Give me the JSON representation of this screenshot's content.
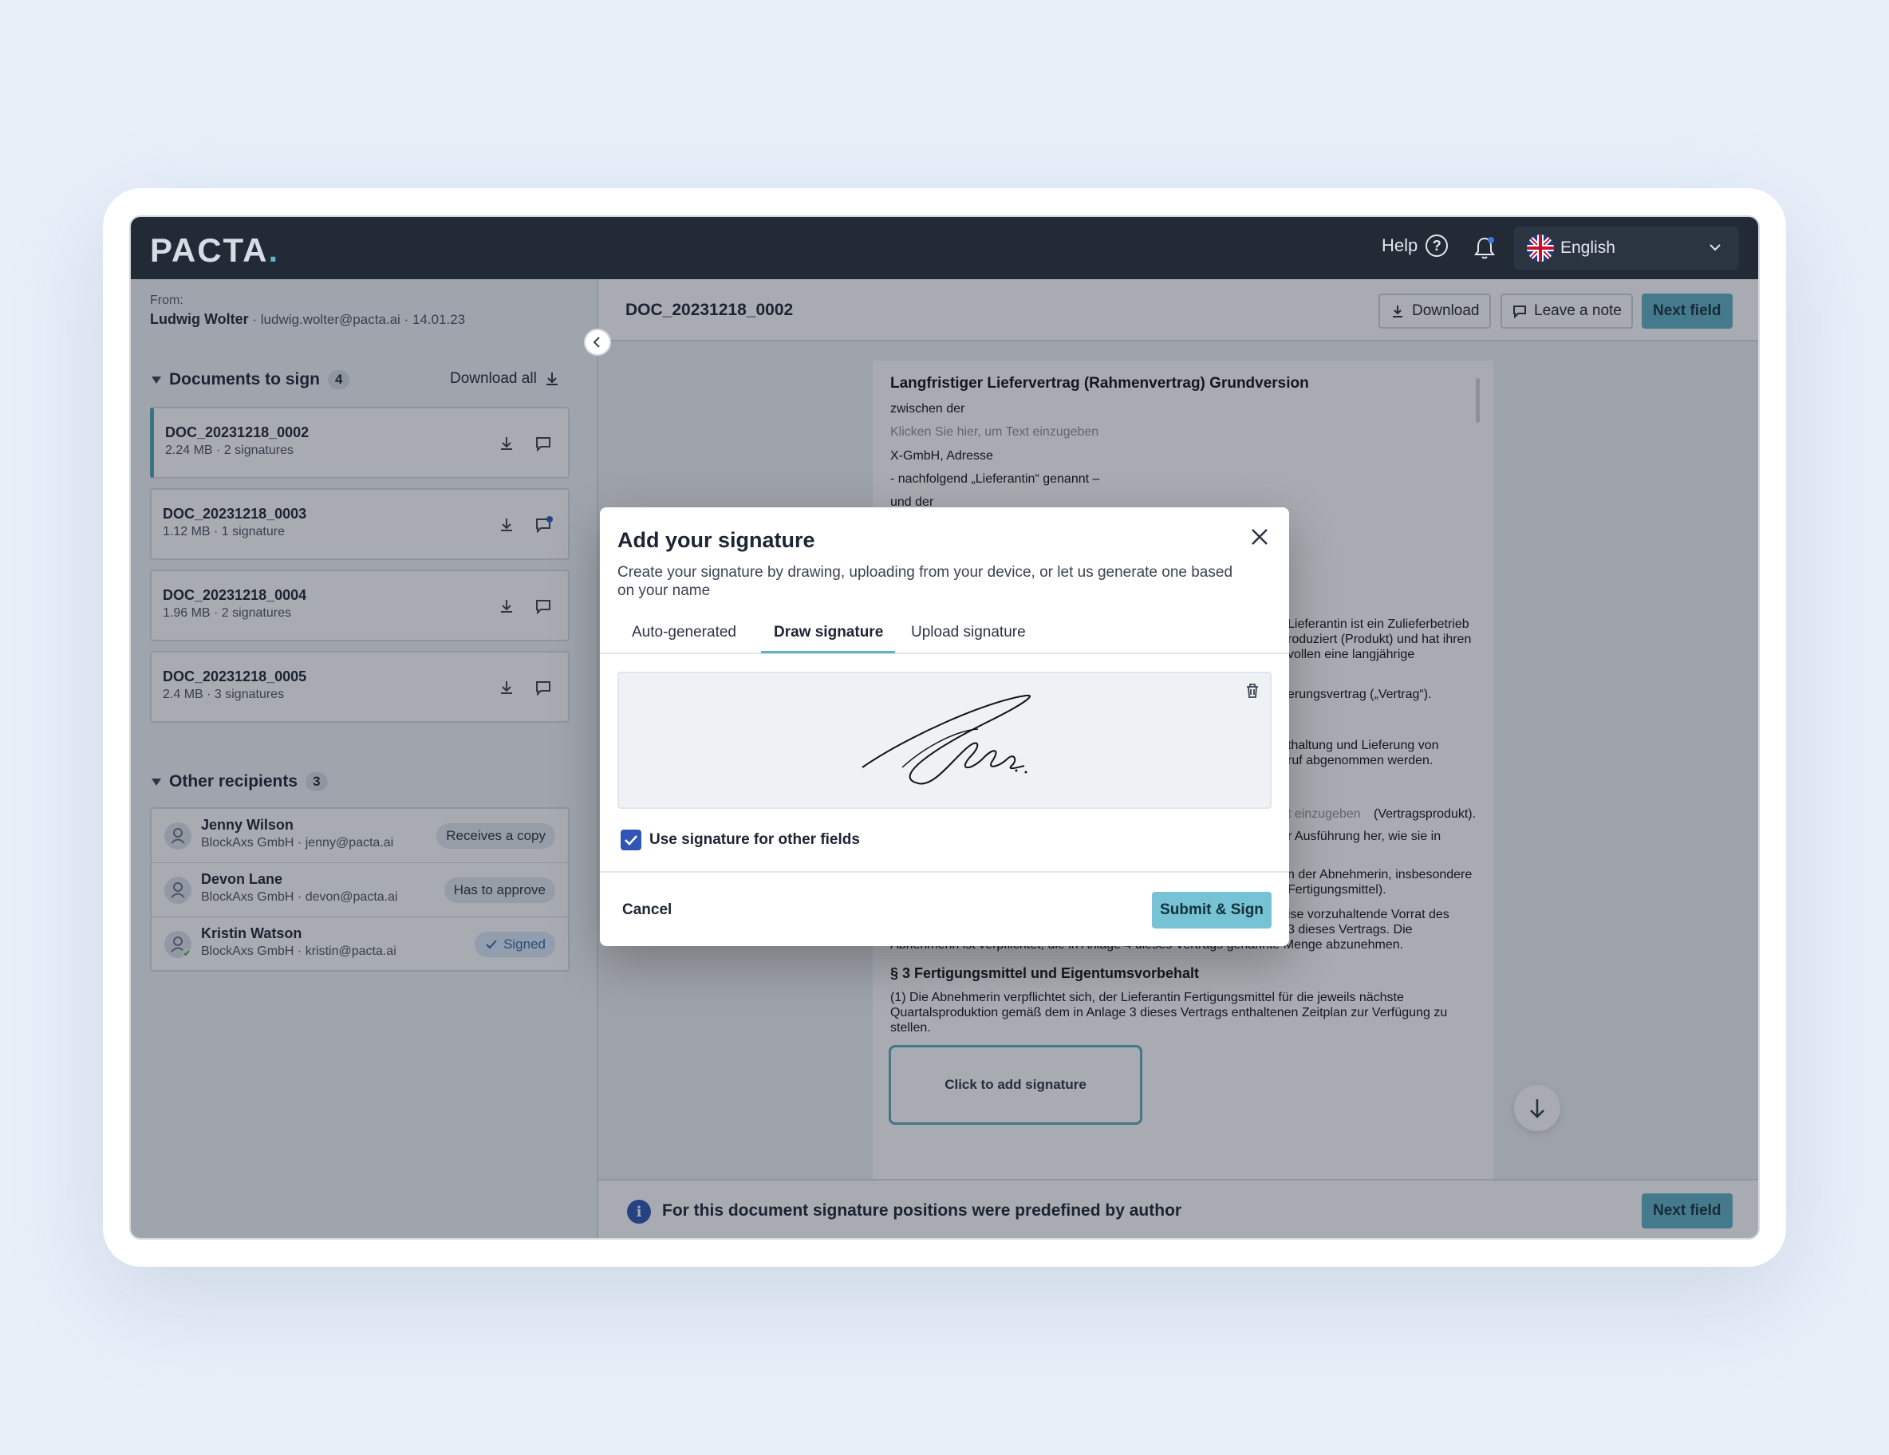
{
  "app": {
    "logo": "PACTA",
    "logo_dot": ".",
    "help": "Help",
    "help_icon": "?",
    "language": "English"
  },
  "sender": {
    "label": "From:",
    "name": "Ludwig Wolter",
    "details": "· ludwig.wolter@pacta.ai · 14.01.23"
  },
  "documents": {
    "title": "Documents to sign",
    "count": "4",
    "download_all": "Download all",
    "items": [
      {
        "name": "DOC_20231218_0002",
        "meta": "2.24 MB · 2 signatures"
      },
      {
        "name": "DOC_20231218_0003",
        "meta": "1.12 MB · 1 signature"
      },
      {
        "name": "DOC_20231218_0004",
        "meta": "1.96 MB · 2 signatures"
      },
      {
        "name": "DOC_20231218_0005",
        "meta": "2.4 MB · 3 signatures"
      }
    ]
  },
  "recipients": {
    "title": "Other recipients",
    "count": "3",
    "items": [
      {
        "name": "Jenny Wilson",
        "meta": "BlockAxs GmbH · jenny@pacta.ai",
        "status": "Receives a copy"
      },
      {
        "name": "Devon Lane",
        "meta": "BlockAxs GmbH · devon@pacta.ai",
        "status": "Has to approve"
      },
      {
        "name": "Kristin Watson",
        "meta": "BlockAxs GmbH · kristin@pacta.ai",
        "status": "Signed"
      }
    ]
  },
  "viewer": {
    "title": "DOC_20231218_0002",
    "download": "Download",
    "leave_note": "Leave a note",
    "next_field": "Next field",
    "footer_info": "For this document signature positions were predefined by author",
    "info_icon": "i",
    "signature_field": "Click to add signature"
  },
  "contract": {
    "heading": "Langfristiger Liefervertrag (Rahmenvertrag) Grundversion",
    "lines": [
      "zwischen der",
      "Klicken Sie hier, um Text einzugeben",
      "X-GmbH, Adresse",
      "- nachfolgend „Lieferantin“ genannt –",
      "und der"
    ],
    "right_fragments": [
      "Lieferantin ist ein Zulieferbetrieb",
      "roduziert (Produkt) und hat ihren",
      "vollen eine langjährige",
      "erungsvertrag („Vertrag“).",
      "thaltung und Lieferung von",
      "ruf abgenommen werden.",
      "t einzugeben",
      "(Vertragsprodukt).",
      "r Ausführung her, wie sie in",
      "n der Abnehmerin, insbesondere",
      "Fertigungsmittel).",
      "ise vorzuhaltende Vorrat des",
      "3 dieses Vertrags. Die",
      "Abnehmerin ist verpflichtet, die in Anlage 4 dieses Vertrags genannte Menge abzunehmen."
    ],
    "section3": "§ 3 Fertigungsmittel und Eigentumsvorbehalt",
    "section3_text": [
      "(1) Die Abnehmerin verpflichtet sich, der Lieferantin Fertigungsmittel für die jeweils nächste",
      "Quartalsproduktion gemäß dem in Anlage 3 dieses Vertrags enthaltenen Zeitplan zur Verfügung zu",
      "stellen."
    ]
  },
  "modal": {
    "title": "Add your signature",
    "description": "Create your signature by drawing, uploading from your device, or let us generate one based on your name",
    "tabs": [
      "Auto-generated",
      "Draw signature",
      "Upload signature"
    ],
    "active_tab": "Draw signature",
    "checkbox_label": "Use signature for other fields",
    "checkbox_checked": true,
    "cancel": "Cancel",
    "submit": "Submit & Sign"
  },
  "colors": {
    "topbar": "#222a36",
    "accent": "#5fb1c5",
    "info": "#2f56b4"
  }
}
